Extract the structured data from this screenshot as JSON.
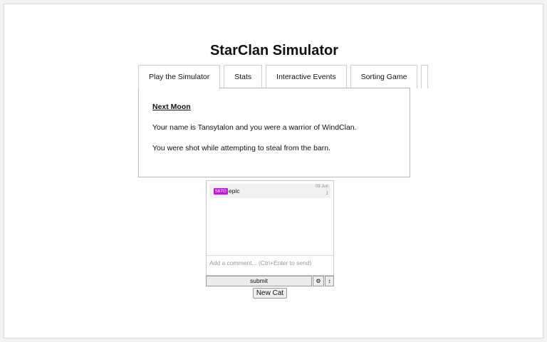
{
  "app": {
    "title": "StarClan Simulator"
  },
  "tabs": [
    {
      "label": "Play the Simulator"
    },
    {
      "label": "Stats"
    },
    {
      "label": "Interactive Events"
    },
    {
      "label": "Sorting Game"
    }
  ],
  "panel": {
    "heading": "Next Moon",
    "line1": "Your name is Tansytalon and you were a warrior of WindClan.",
    "line2": "You were shot while attempting to steal from the barn."
  },
  "comments": {
    "items": [
      {
        "tag": "567G",
        "text": "epic",
        "date": "09 Jun",
        "count": "1"
      }
    ],
    "placeholder": "Add a comment... (Ctrl+Enter to send)",
    "submit_label": "submit",
    "gear_icon": "⚙",
    "updown_icon": "↕"
  },
  "new_cat_label": "New Cat",
  "colors": {
    "tag": "#b81cd6"
  }
}
